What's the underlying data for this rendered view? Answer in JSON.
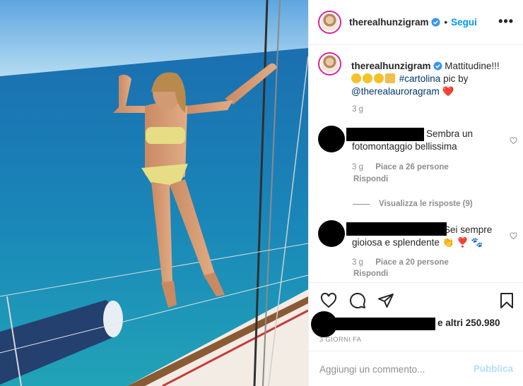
{
  "post": {
    "username": "therealhunzigram",
    "follow_label": "Segui",
    "separator": "•",
    "more_label": "•••"
  },
  "caption": {
    "username": "therealhunzigram",
    "text_1": "Mattitudine!!!",
    "hashtag": "#cartolina",
    "text_2": "pic by",
    "mention": "@therealauroragram",
    "heart": "❤️",
    "time": "3 g"
  },
  "comments": [
    {
      "text": "Sembra un fotomontaggio bellissima",
      "time": "3 g",
      "likes": "Piace a 26 persone",
      "reply": "Rispondi"
    },
    {
      "text": "Sei sempre gioiosa e splendente",
      "emoji": "👏 ❣️ 🐾",
      "time": "3 g",
      "likes": "Piace a 20 persone",
      "reply": "Rispondi"
    }
  ],
  "view_replies": "Visualizza le risposte (9)",
  "actions": {
    "icons": [
      "heart-icon",
      "comment-icon",
      "share-icon",
      "bookmark-icon"
    ]
  },
  "likes_summary": "e altri 250.980",
  "time_ago": "3 GIORNI FA",
  "add_comment": {
    "placeholder": "Aggiungi un commento...",
    "publish_label": "Pubblica"
  },
  "colors": {
    "link": "#00376b",
    "follow": "#0095f6",
    "publish_disabled": "#b2dffc",
    "muted": "#8e8e8e"
  }
}
